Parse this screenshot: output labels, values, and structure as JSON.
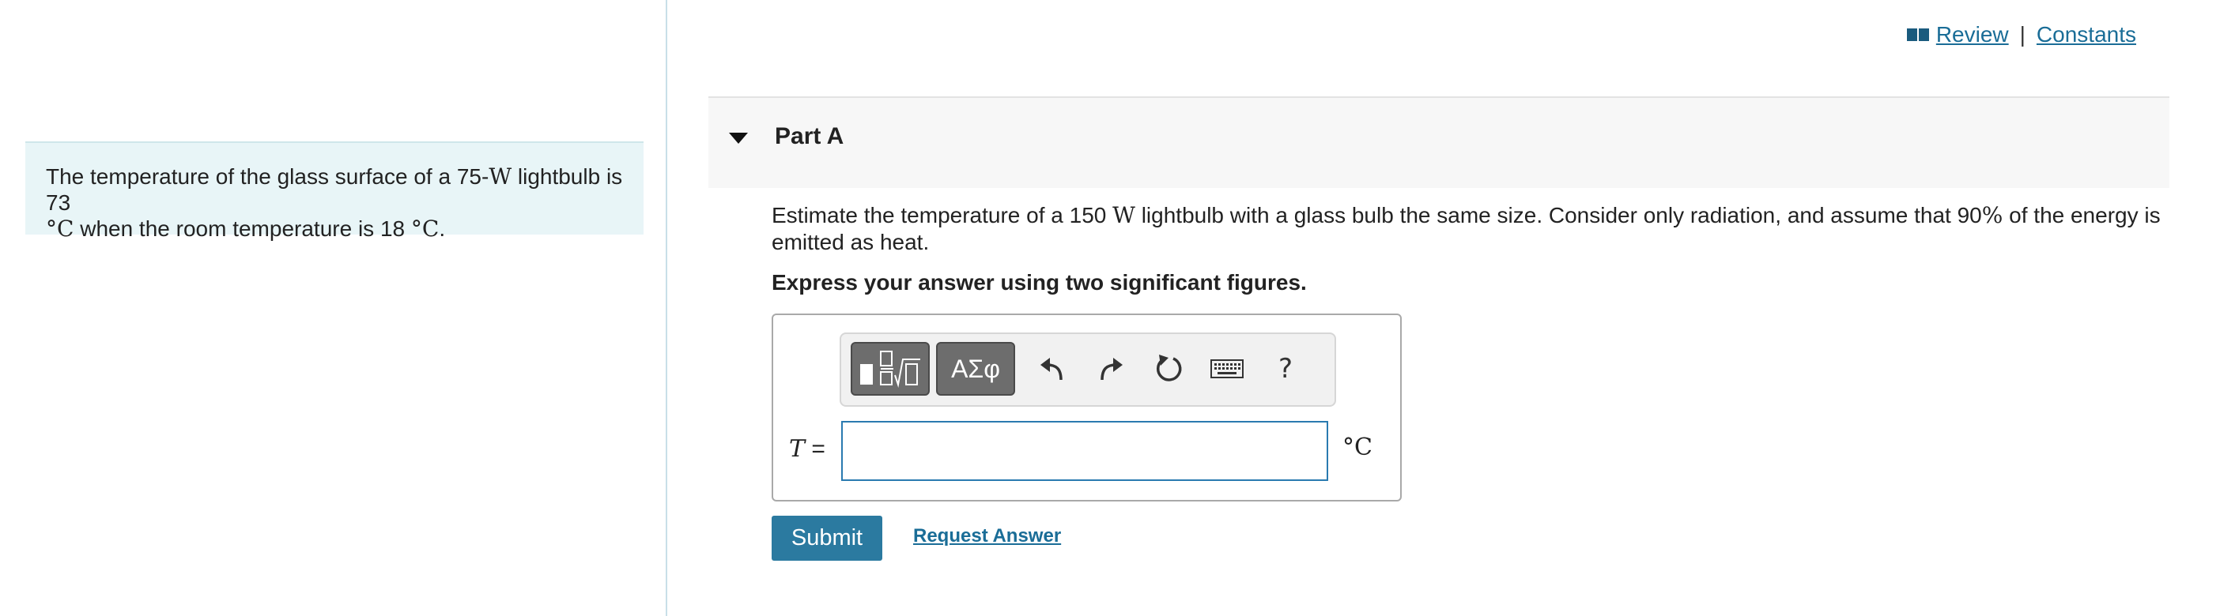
{
  "problem": {
    "text_a": "The temperature of the glass surface of a 75-",
    "unit_w": "W",
    "text_b": " lightbulb is 73",
    "unit_c": "°C",
    "text_c": " when the room temperature is 18 ",
    "unit_c2": "°C",
    "text_d": "."
  },
  "links": {
    "review": "Review",
    "separator": "|",
    "constants": "Constants"
  },
  "part": {
    "title": "Part A"
  },
  "question": {
    "text_a": "Estimate the temperature of a 150 ",
    "unit_w": "W",
    "text_b": " lightbulb with a glass bulb the same size. Consider only radiation, and assume that 90",
    "percent": "%",
    "text_c": " of the energy is emitted as heat.",
    "instruction": "Express your answer using two significant figures."
  },
  "toolbar": {
    "symbols_label": "ΑΣφ",
    "help_label": "?"
  },
  "answer": {
    "variable": "T",
    "equals": " =",
    "value": "",
    "unit": "°C"
  },
  "actions": {
    "submit": "Submit",
    "request_answer": "Request Answer"
  },
  "colors": {
    "accent": "#2b7aa0",
    "link": "#1a6d97",
    "problem_bg": "#e8f5f7"
  }
}
